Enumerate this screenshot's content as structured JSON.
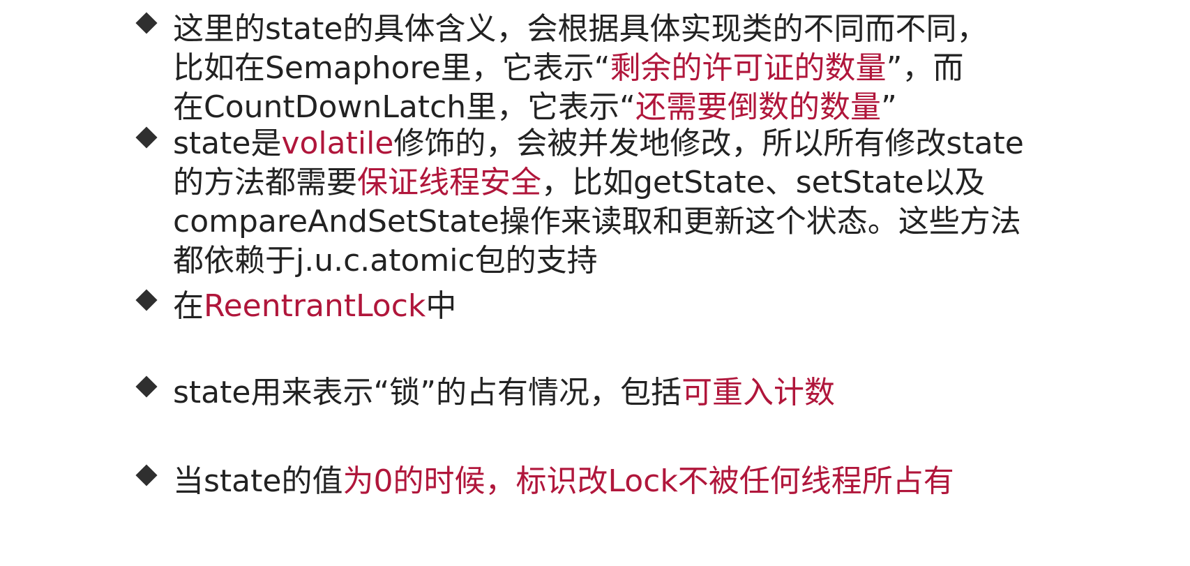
{
  "bullets": [
    {
      "lines": [
        [
          {
            "text": "这里的state的具体含义，会根据具体实现类的不同而不同，",
            "color": "normal"
          }
        ],
        [
          {
            "text": "比如在Semaphore里，它表示“",
            "color": "normal"
          },
          {
            "text": "剩余的许可证的数量",
            "color": "red"
          },
          {
            "text": "”，而",
            "color": "normal"
          }
        ],
        [
          {
            "text": "在CountDownLatch里，它表示“",
            "color": "normal"
          },
          {
            "text": "还需要倒数的数量",
            "color": "red"
          },
          {
            "text": "”",
            "color": "normal"
          }
        ]
      ]
    },
    {
      "lines": [
        [
          {
            "text": "state是",
            "color": "normal"
          },
          {
            "text": "volatile",
            "color": "red"
          },
          {
            "text": "修饰的，会被并发地修改，所以所有修改state",
            "color": "normal"
          }
        ],
        [
          {
            "text": "的方法都需要",
            "color": "normal"
          },
          {
            "text": "保证线程安全",
            "color": "red"
          },
          {
            "text": "，比如getState、setState以及",
            "color": "normal"
          }
        ],
        [
          {
            "text": "compareAndSetState操作来读取和更新这个状态。这些方法",
            "color": "normal"
          }
        ],
        [
          {
            "text": "都依赖于j.u.c.atomic包的支持",
            "color": "normal"
          }
        ]
      ]
    },
    {
      "lines": [
        [
          {
            "text": "在",
            "color": "normal"
          },
          {
            "text": "ReentrantLock",
            "color": "red"
          },
          {
            "text": "中",
            "color": "normal"
          }
        ]
      ]
    },
    {
      "lines": [
        [
          {
            "text": "state用来表示“锁”的占有情况，包括",
            "color": "normal"
          },
          {
            "text": "可重入计数",
            "color": "red"
          }
        ]
      ]
    },
    {
      "lines": [
        [
          {
            "text": "当state的值",
            "color": "normal"
          },
          {
            "text": "为0的时候，标识改Lock不被任何线程所占有",
            "color": "red"
          }
        ]
      ]
    }
  ]
}
